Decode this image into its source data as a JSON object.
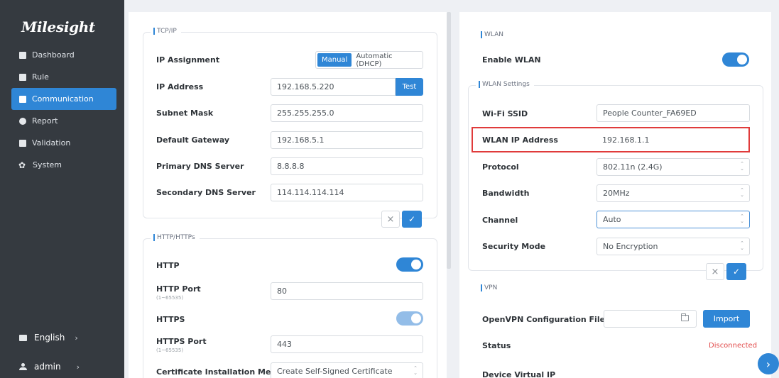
{
  "brand": {
    "logo": "Milesight"
  },
  "sidebar": {
    "items": [
      {
        "label": "Dashboard",
        "icon": "dashboard-icon"
      },
      {
        "label": "Rule",
        "icon": "rule-icon"
      },
      {
        "label": "Communication",
        "icon": "communication-icon",
        "active": true
      },
      {
        "label": "Report",
        "icon": "report-icon"
      },
      {
        "label": "Validation",
        "icon": "validation-icon"
      },
      {
        "label": "System",
        "icon": "gear-icon"
      }
    ],
    "language": "English",
    "user": "admin",
    "chevron": "›"
  },
  "tcpip": {
    "legend": "TCP/IP",
    "ip_assignment_label": "IP Assignment",
    "mode_manual": "Manual",
    "mode_dhcp": "Automatic (DHCP)",
    "ip_address_label": "IP Address",
    "ip_address": "192.168.5.220",
    "test_label": "Test",
    "subnet_label": "Subnet Mask",
    "subnet": "255.255.255.0",
    "gateway_label": "Default Gateway",
    "gateway": "192.168.5.1",
    "dns1_label": "Primary DNS Server",
    "dns1": "8.8.8.8",
    "dns2_label": "Secondary DNS Server",
    "dns2": "114.114.114.114",
    "cancel": "×",
    "save": "✓"
  },
  "http": {
    "legend": "HTTP/HTTPs",
    "http_label": "HTTP",
    "http_port_label": "HTTP Port",
    "http_port_range": "(1~65535)",
    "http_port": "80",
    "https_label": "HTTPS",
    "https_port_label": "HTTPS Port",
    "https_port_range": "(1~65535)",
    "https_port": "443",
    "cert_label": "Certificate Installation Method",
    "cert_value": "Create Self-Signed Certificate"
  },
  "wlan": {
    "title": "WLAN",
    "enable_label": "Enable WLAN",
    "settings_legend": "WLAN Settings",
    "ssid_label": "Wi-Fi SSID",
    "ssid": "People Counter_FA69ED",
    "ip_label": "WLAN IP Address",
    "ip": "192.168.1.1",
    "protocol_label": "Protocol",
    "protocol": "802.11n (2.4G)",
    "bandwidth_label": "Bandwidth",
    "bandwidth": "20MHz",
    "channel_label": "Channel",
    "channel": "Auto",
    "security_label": "Security Mode",
    "security": "No Encryption",
    "cancel": "×",
    "save": "✓"
  },
  "vpn": {
    "title": "VPN",
    "config_label": "OpenVPN Configuration File",
    "import_label": "Import",
    "status_label": "Status",
    "status": "Disconnected",
    "virtual_ip_label": "Device Virtual IP"
  },
  "colors": {
    "accent": "#2f86d6",
    "sidebar": "#353a40",
    "error": "#e24b4b",
    "highlight": "#e03b3b"
  }
}
